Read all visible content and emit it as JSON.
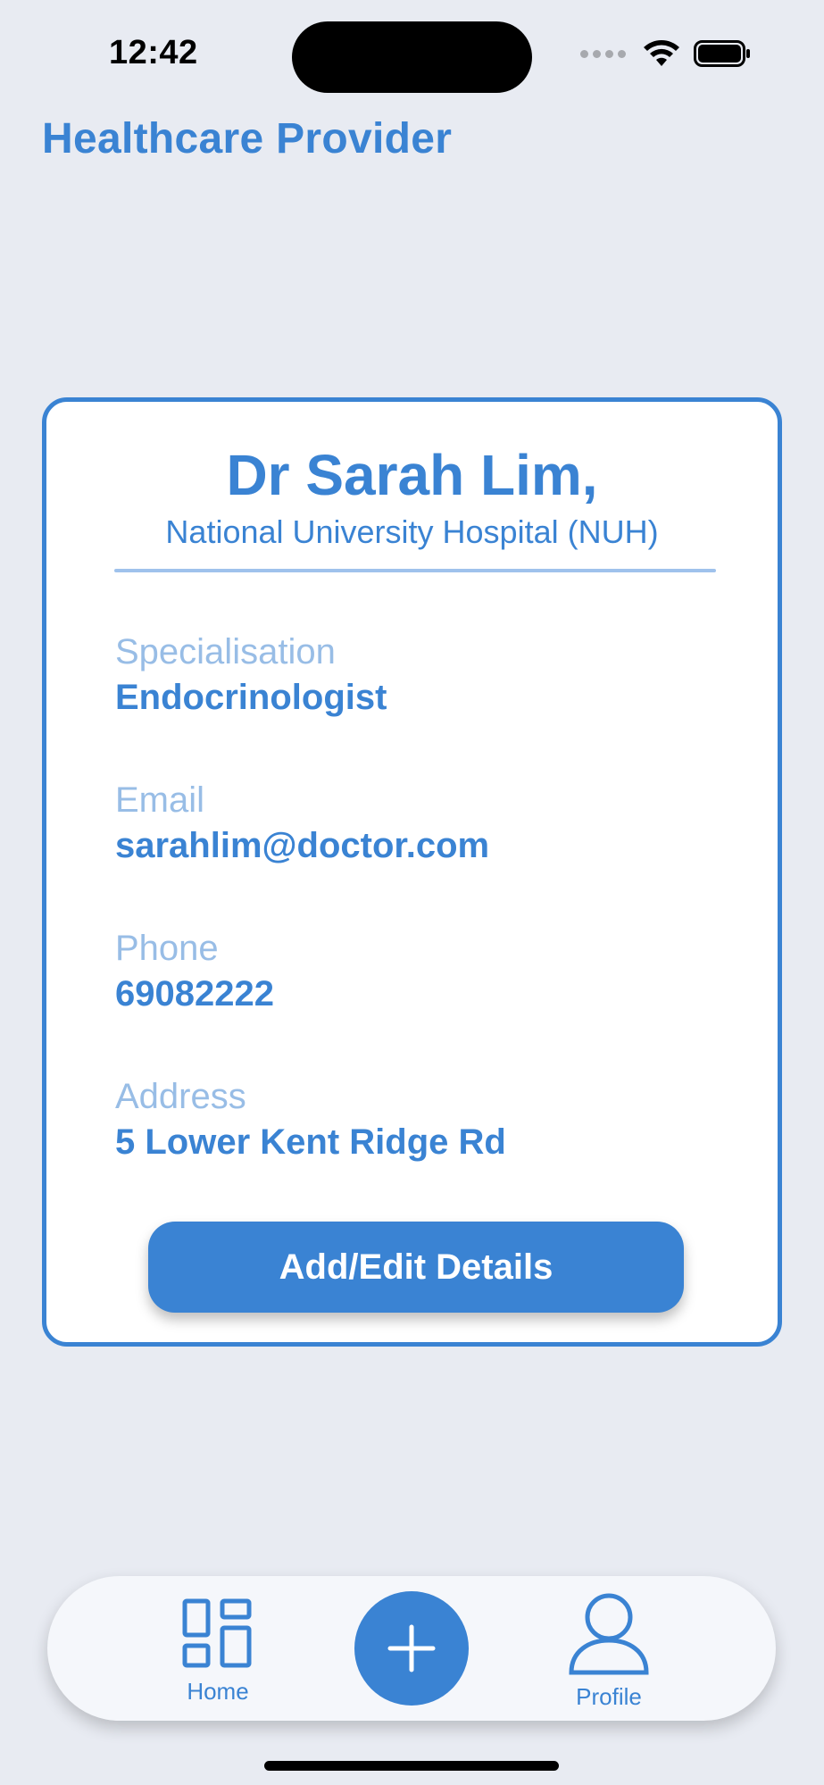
{
  "status_bar": {
    "time": "12:42"
  },
  "header": {
    "title": "Healthcare Provider"
  },
  "profile": {
    "name": "Dr Sarah Lim,",
    "hospital": "National University Hospital (NUH)",
    "fields": [
      {
        "label": "Specialisation",
        "value": "Endocrinologist"
      },
      {
        "label": "Email",
        "value": "sarahlim@doctor.com"
      },
      {
        "label": "Phone",
        "value": "69082222"
      },
      {
        "label": "Address",
        "value": "5 Lower Kent Ridge Rd"
      }
    ],
    "edit_button_label": "Add/Edit Details"
  },
  "tabbar": {
    "home_label": "Home",
    "add_icon": "plus-icon",
    "profile_label": "Profile"
  },
  "colors": {
    "accent": "#3a83d3",
    "label_light": "#98bde6",
    "background": "#e8ebf2"
  }
}
